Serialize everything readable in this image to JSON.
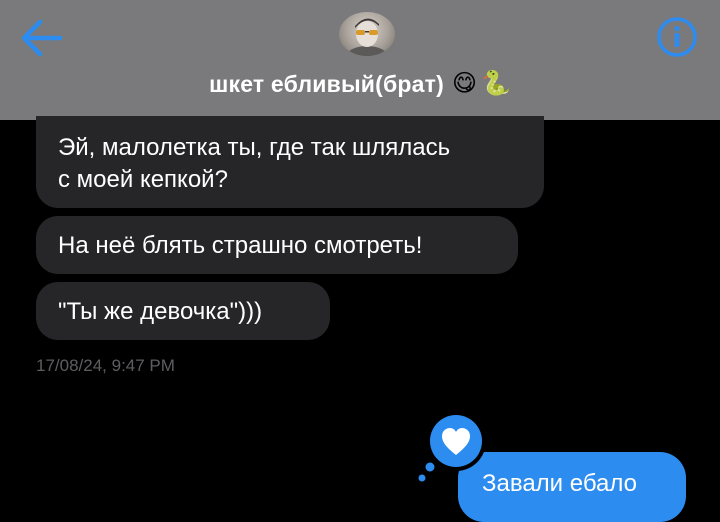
{
  "header": {
    "contact_name": "шкет ебливый(брат)",
    "emojis": [
      "😋",
      "🐍"
    ],
    "back_icon": "back-arrow-icon",
    "info_icon": "info-icon",
    "accent_color": "#2d8cf0"
  },
  "messages": {
    "incoming": [
      "Эй, малолетка ты, где так шлялась\nс моей кепкой?",
      "На неё блять страшно смотреть!",
      "\"Ты же девочка\")))"
    ],
    "timestamp": "17/08/24, 9:47 PM",
    "outgoing": "Завали ебало",
    "outgoing_reaction": "heart-reaction-icon"
  }
}
